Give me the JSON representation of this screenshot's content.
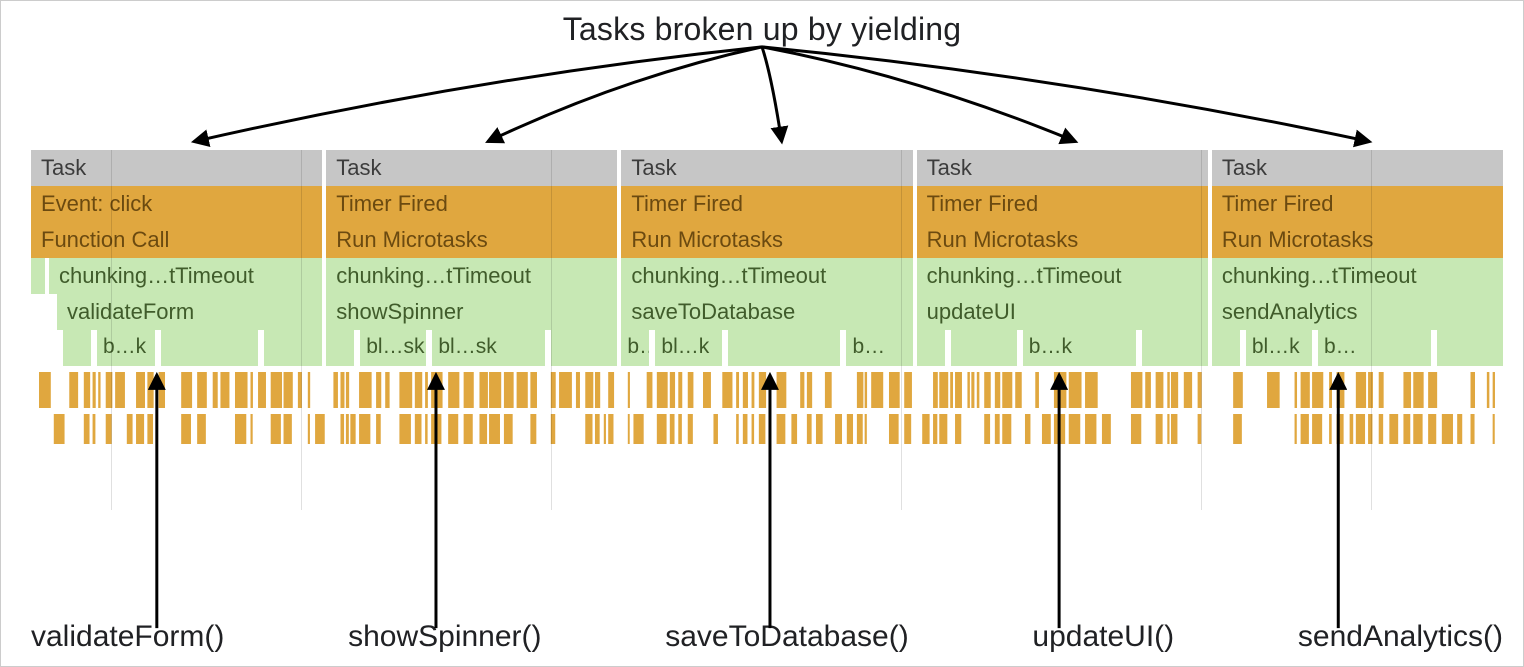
{
  "title": "Tasks broken up by yielding",
  "tasks": [
    {
      "task": "Task",
      "event": "Event: click",
      "func": "Function Call",
      "chunk": "chunking…tTimeout",
      "fn": "validateForm",
      "label": "validateForm()"
    },
    {
      "task": "Task",
      "event": "Timer Fired",
      "func": "Run Microtasks",
      "chunk": "chunking…tTimeout",
      "fn": "showSpinner",
      "label": "showSpinner()"
    },
    {
      "task": "Task",
      "event": "Timer Fired",
      "func": "Run Microtasks",
      "chunk": "chunking…tTimeout",
      "fn": "saveToDatabase",
      "label": "saveToDatabase()"
    },
    {
      "task": "Task",
      "event": "Timer Fired",
      "func": "Run Microtasks",
      "chunk": "chunking…tTimeout",
      "fn": "updateUI",
      "label": "updateUI()"
    },
    {
      "task": "Task",
      "event": "Timer Fired",
      "func": "Run Microtasks",
      "chunk": "chunking…tTimeout",
      "fn": "sendAnalytics",
      "label": "sendAnalytics()"
    }
  ],
  "blk_fragments": [
    [
      "",
      "b…k",
      ""
    ],
    [
      "",
      "bl…sk",
      "bl…sk"
    ],
    [
      "b…",
      "bl…k",
      ""
    ],
    [
      "",
      "",
      "b…k"
    ],
    [
      "",
      "bl…k",
      "b…"
    ]
  ]
}
